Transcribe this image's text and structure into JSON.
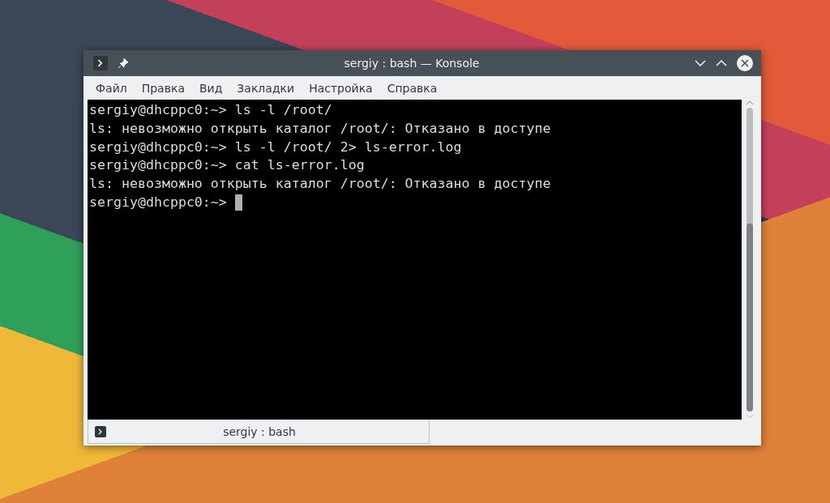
{
  "window": {
    "title": "sergiy : bash — Konsole"
  },
  "menu": [
    "Файл",
    "Правка",
    "Вид",
    "Закладки",
    "Настройка",
    "Справка"
  ],
  "terminal": {
    "lines": [
      "sergiy@dhcppc0:~> ls -l /root/",
      "ls: невозможно открыть каталог /root/: Отказано в доступе",
      "sergiy@dhcppc0:~> ls -l /root/ 2> ls-error.log",
      "sergiy@dhcppc0:~> cat ls-error.log",
      "ls: невозможно открыть каталог /root/: Отказано в доступе",
      "sergiy@dhcppc0:~>"
    ],
    "cursor": true
  },
  "tabs": [
    {
      "label": "sergiy : bash",
      "selected": true
    }
  ]
}
